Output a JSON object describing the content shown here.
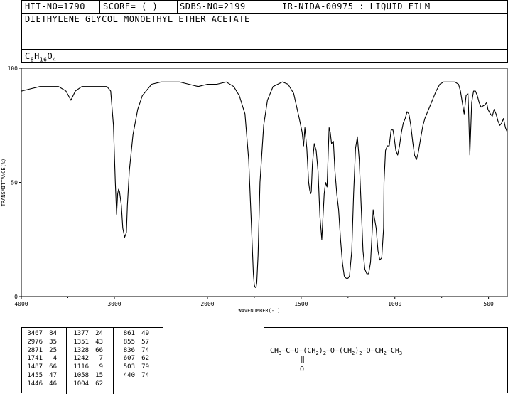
{
  "header": {
    "hit_no": "HIT-NO=1790",
    "score": "SCORE=  (   )",
    "sdbs_no": "SDBS-NO=2199",
    "ir_id": "IR-NIDA-00975 : LIQUID FILM",
    "compound_name": "DIETHYLENE GLYCOL MONOETHYL ETHER ACETATE",
    "formula_parts": [
      "C",
      "8",
      "H",
      "16",
      "O",
      "4"
    ]
  },
  "chart_data": {
    "type": "line",
    "title": "",
    "xlabel": "WAVENUMBER(-1)",
    "ylabel": "TRANSMITTANCE(%)",
    "xlim": [
      4000,
      400
    ],
    "ylim": [
      0,
      100
    ],
    "x_ticks": [
      4000,
      3000,
      2000,
      1500,
      1000,
      500
    ],
    "y_ticks": [
      0,
      50,
      100
    ],
    "x_tick_labels": [
      "4000",
      "3000",
      "2000",
      "1500",
      "1000",
      "500"
    ],
    "y_tick_labels": [
      "0",
      "50",
      "100"
    ],
    "grid": false,
    "series": [
      {
        "x": [
          4000,
          3900,
          3800,
          3700,
          3600,
          3520,
          3467,
          3420,
          3350,
          3250,
          3150,
          3080,
          3040,
          3010,
          2990,
          2976,
          2965,
          2955,
          2945,
          2925,
          2910,
          2890,
          2871,
          2860,
          2840,
          2800,
          2750,
          2700,
          2600,
          2500,
          2400,
          2300,
          2200,
          2100,
          2000,
          1950,
          1900,
          1860,
          1830,
          1800,
          1780,
          1765,
          1755,
          1750,
          1745,
          1741,
          1737,
          1730,
          1720,
          1700,
          1680,
          1650,
          1600,
          1570,
          1540,
          1510,
          1495,
          1487,
          1480,
          1470,
          1460,
          1455,
          1450,
          1446,
          1440,
          1430,
          1420,
          1410,
          1400,
          1390,
          1377,
          1370,
          1362,
          1351,
          1345,
          1338,
          1328,
          1320,
          1310,
          1300,
          1290,
          1280,
          1270,
          1260,
          1250,
          1242,
          1230,
          1220,
          1210,
          1200,
          1190,
          1180,
          1170,
          1160,
          1150,
          1140,
          1130,
          1120,
          1116,
          1110,
          1100,
          1090,
          1080,
          1070,
          1060,
          1058,
          1050,
          1040,
          1030,
          1020,
          1010,
          1004,
          995,
          985,
          975,
          965,
          955,
          945,
          935,
          925,
          915,
          905,
          895,
          885,
          875,
          861,
          850,
          840,
          830,
          820,
          810,
          800,
          780,
          760,
          740,
          720,
          700,
          680,
          660,
          650,
          640,
          630,
          620,
          610,
          607,
          600,
          590,
          580,
          570,
          560,
          550,
          540,
          520,
          510,
          503,
          490,
          480,
          470,
          460,
          450,
          440,
          430,
          420,
          410,
          400
        ],
        "y": [
          90,
          91,
          92,
          92,
          92,
          90,
          86,
          90,
          92,
          92,
          92,
          92,
          90,
          75,
          50,
          36,
          45,
          47,
          46,
          40,
          30,
          26,
          28,
          40,
          55,
          71,
          82,
          88,
          93,
          94,
          94,
          94,
          93,
          92,
          93,
          93,
          94,
          92,
          88,
          80,
          60,
          30,
          10,
          5,
          4,
          4,
          6,
          18,
          50,
          75,
          86,
          92,
          94,
          93,
          89,
          78,
          72,
          66,
          74,
          65,
          50,
          47,
          45,
          46,
          58,
          67,
          64,
          55,
          35,
          25,
          45,
          50,
          48,
          74,
          72,
          67,
          68,
          55,
          45,
          38,
          25,
          15,
          9,
          8,
          8,
          9,
          20,
          45,
          65,
          70,
          60,
          40,
          20,
          12,
          10,
          10,
          15,
          30,
          38,
          35,
          30,
          20,
          16,
          17,
          30,
          50,
          64,
          66,
          66,
          73,
          73,
          70,
          64,
          62,
          66,
          72,
          76,
          78,
          81,
          80,
          75,
          68,
          62,
          60,
          63,
          70,
          75,
          78,
          80,
          82,
          84,
          86,
          90,
          93,
          94,
          94,
          94,
          94,
          93,
          90,
          85,
          80,
          88,
          89,
          83,
          62,
          85,
          90,
          90,
          88,
          85,
          83,
          84,
          85,
          82,
          80,
          79,
          82,
          80,
          77,
          75,
          76,
          78,
          74,
          72
        ]
      }
    ]
  },
  "peak_table": [
    {
      "wn": "3467",
      "t": "84"
    },
    {
      "wn": "2976",
      "t": "35"
    },
    {
      "wn": "2871",
      "t": "25"
    },
    {
      "wn": "1741",
      "t": "4"
    },
    {
      "wn": "1487",
      "t": "66"
    },
    {
      "wn": "1455",
      "t": "47"
    },
    {
      "wn": "1446",
      "t": "46"
    },
    {
      "wn": "1377",
      "t": "24"
    },
    {
      "wn": "1351",
      "t": "43"
    },
    {
      "wn": "1328",
      "t": "66"
    },
    {
      "wn": "1242",
      "t": "7"
    },
    {
      "wn": "1116",
      "t": "9"
    },
    {
      "wn": "1058",
      "t": "15"
    },
    {
      "wn": "1004",
      "t": "62"
    },
    {
      "wn": "861",
      "t": "49"
    },
    {
      "wn": "855",
      "t": "57"
    },
    {
      "wn": "836",
      "t": "74"
    },
    {
      "wn": "607",
      "t": "62"
    },
    {
      "wn": "503",
      "t": "79"
    },
    {
      "wn": "440",
      "t": "74"
    }
  ],
  "structure": {
    "parts": [
      {
        "text": "CH",
        "sub": "3"
      },
      {
        "text": "—C—O—(CH",
        "sub": "2"
      },
      {
        "text": ")",
        "sub": "2"
      },
      {
        "text": "—O—(CH",
        "sub": "2"
      },
      {
        "text": ")",
        "sub": "2"
      },
      {
        "text": "—O—CH",
        "sub": "2"
      },
      {
        "text": "—CH",
        "sub": "3"
      }
    ],
    "carbonyl_o": "O"
  }
}
